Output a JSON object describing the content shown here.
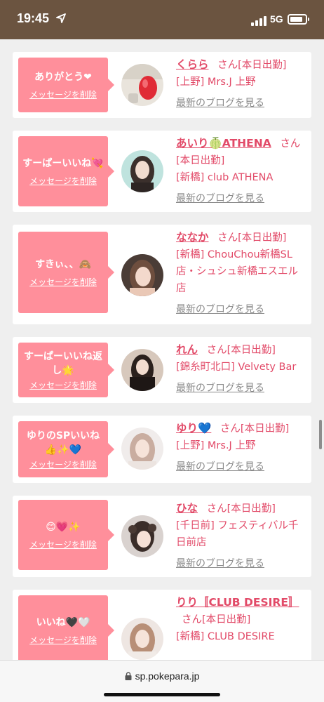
{
  "status": {
    "time": "19:45",
    "network": "5G"
  },
  "browser": {
    "url": "sp.pokepara.jp"
  },
  "delete_label": "メッセージを削除",
  "blog_label": "最新のブログを見る",
  "colors": {
    "accent": "#ff8f9b",
    "name": "#e24a68",
    "header": "#6b5440"
  },
  "cards": [
    {
      "message": "ありがとう❤",
      "name": "くらら",
      "suffix": "さん[本日出勤]",
      "shop": "[上野] Mrs.J 上野"
    },
    {
      "message": "すーぱーいいね💘",
      "name": "あいり🍈ATHENA",
      "suffix": "さん[本日出勤]",
      "shop": "[新橋] club ATHENA"
    },
    {
      "message": "すきぃ、、🙈",
      "name": "ななか",
      "suffix": "さん[本日出勤]",
      "shop": "[新橋] ChouChou新橋SL店・シュシュ新橋エスエル店"
    },
    {
      "message": "すーぱーいいね返し🌟",
      "name": "れん",
      "suffix": "さん[本日出勤]",
      "shop": "[錦糸町北口] Velvety Bar"
    },
    {
      "message": "ゆりのSPいいね👍✨💙",
      "name": "ゆり💙",
      "suffix": "さん[本日出勤]",
      "shop": "[上野] Mrs.J 上野"
    },
    {
      "message": "😊💗✨",
      "name": "ひな",
      "suffix": "さん[本日出勤]",
      "shop": "[千日前] フェスティバル千日前店"
    },
    {
      "message": "いいね🖤🤍",
      "name": "りり〚CLUB DESIRE〛",
      "suffix": "さん[本日出勤]",
      "shop": "[新橋] CLUB DESIRE"
    }
  ]
}
